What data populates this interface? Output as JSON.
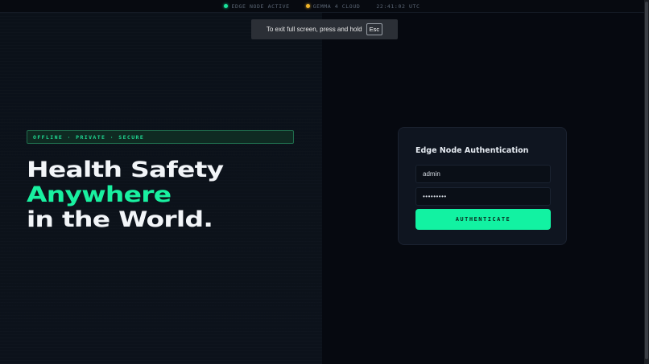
{
  "status_bar": {
    "edge_node": "EDGE NODE ACTIVE",
    "cloud": "GEMMA 4 CLOUD",
    "time": "22:41:02 UTC"
  },
  "fullscreen_toast": {
    "message": "To exit full screen, press and hold",
    "key": "Esc"
  },
  "hero": {
    "badge": "OFFLINE · PRIVATE · SECURE",
    "line1": "Health Safety",
    "line2": "Anywhere",
    "line3": "in the World."
  },
  "auth": {
    "title": "Edge Node Authentication",
    "username_value": "admin",
    "password_value": "•••••••••",
    "submit_label": "AUTHENTICATE"
  },
  "colors": {
    "accent": "#19f0a0",
    "status_active": "#19e39a",
    "status_cloud": "#f0b429"
  }
}
